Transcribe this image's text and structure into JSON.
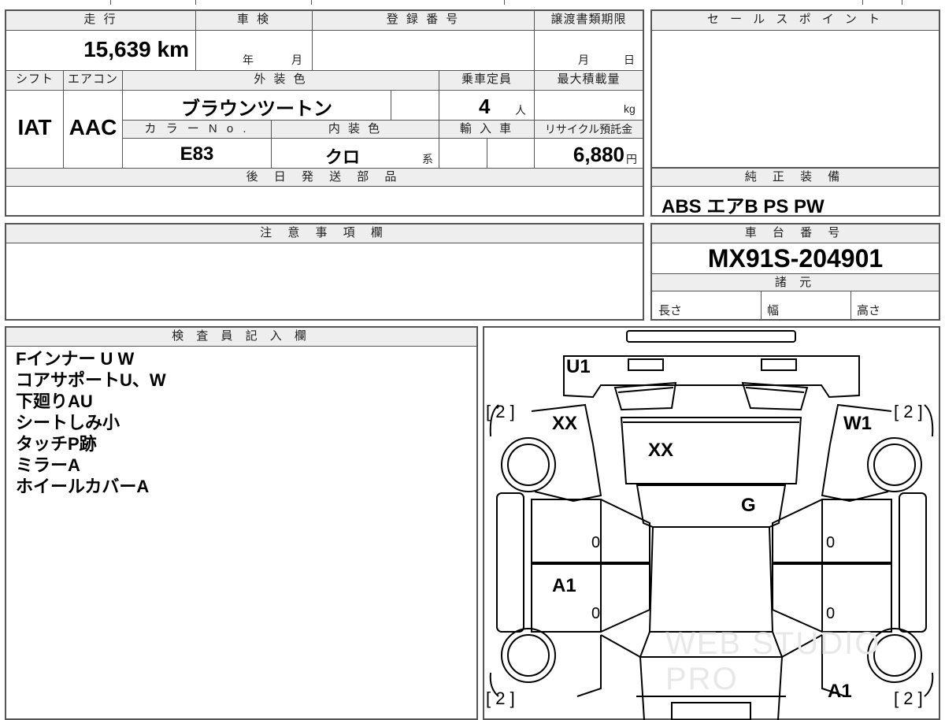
{
  "spec": {
    "labels": {
      "mileage": "走 行",
      "inspection": "車 検",
      "registration": "登 録 番 号",
      "transfer_deadline": "譲渡書類期限",
      "shift": "シフト",
      "aircon": "エアコン",
      "exterior_color": "外 装 色",
      "capacity": "乗車定員",
      "max_load": "最大積載量",
      "color_no": "カ ラ ー N o .",
      "interior_color": "内 装 色",
      "imported": "輸 入 車",
      "recycle": "リサイクル預託金",
      "later_parts": "後 日 発 送 部 品"
    },
    "mileage_value": "15,639",
    "mileage_unit": "km",
    "year_unit": "年",
    "month_unit": "月",
    "deadline_month": "月",
    "deadline_day": "日",
    "shift_value": "IAT",
    "aircon_value": "AAC",
    "exterior_color_value": "ブラウンツートン",
    "capacity_value": "4",
    "capacity_unit": "人",
    "load_unit": "kg",
    "color_no_value": "E83",
    "interior_color_value": "クロ",
    "interior_suffix": "系",
    "recycle_value": "6,880",
    "recycle_unit": "円"
  },
  "sale_points": {
    "header": "セ ー ル ス ポ イ ン ト"
  },
  "equipment": {
    "header": "純 正 装 備",
    "value": "ABS エアB PS PW"
  },
  "caution": {
    "header": "注 意 事 項 欄"
  },
  "chassis": {
    "header": "車 台 番 号",
    "value": "MX91S-204901",
    "specs_header": "諸 元",
    "length": "長さ",
    "width": "幅",
    "height": "高さ"
  },
  "inspector": {
    "header": "検 査 員 記 入 欄",
    "notes": [
      "Fインナー U W",
      "コアサポートU、W",
      "下廻りAU",
      "シートしみ小",
      "タッチP跡",
      "ミラーA",
      "ホイールカバーA"
    ]
  },
  "diagram": {
    "marks": {
      "u1": "U1",
      "xx_left": "XX",
      "xx_hood": "XX",
      "w1": "W1",
      "g": "G",
      "a1_left": "A1",
      "a1_right": "A1",
      "zero_lf": "0",
      "zero_lr": "0",
      "zero_rf": "0",
      "zero_rr": "0",
      "bracket_tl": "[ 2 ]",
      "bracket_tr": "[ 2 ]",
      "bracket_bl": "[ 2 ]",
      "bracket_br": "[ 2 ]"
    },
    "watermark": "WEB STUDIO PRO"
  }
}
